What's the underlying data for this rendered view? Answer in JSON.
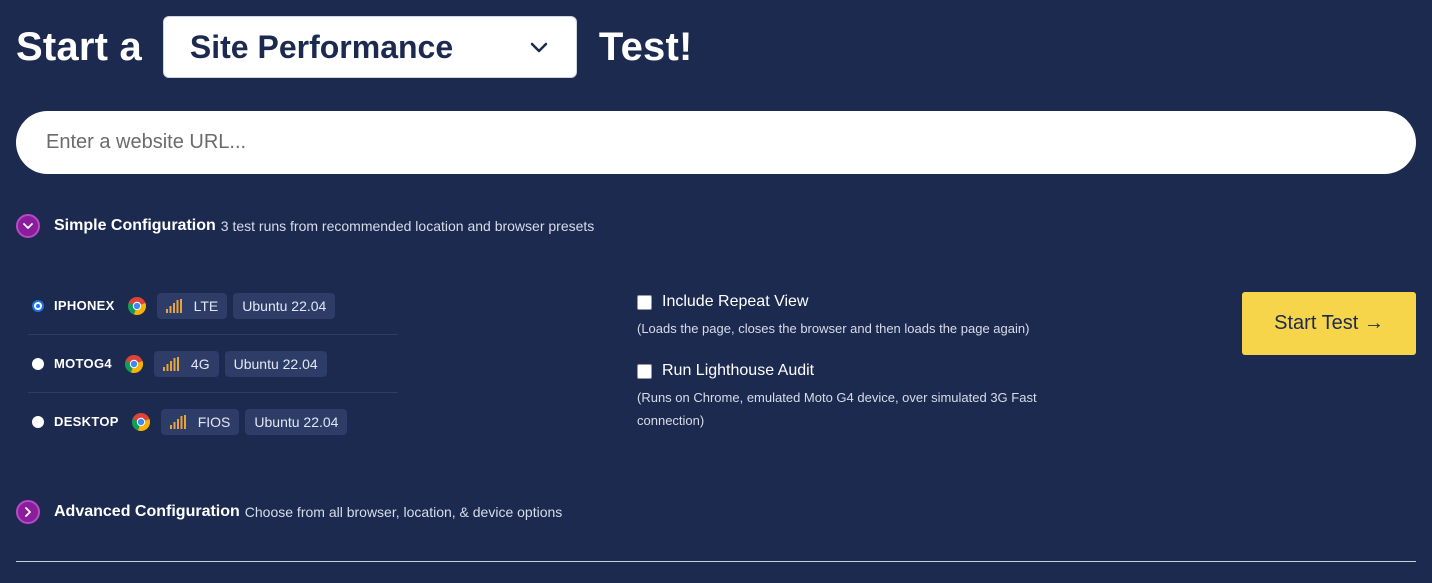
{
  "headline": {
    "prefix": "Start a",
    "selected_test": "Site Performance",
    "suffix": "Test!"
  },
  "url_input": {
    "placeholder": "Enter a website URL...",
    "value": ""
  },
  "simple_config": {
    "title": "Simple Configuration",
    "description": "3 test runs from recommended location and browser presets",
    "expanded": true
  },
  "presets": [
    {
      "device": "IPHONEX",
      "browser_icon": "chrome-icon",
      "connection": "LTE",
      "os": "Ubuntu 22.04",
      "selected": true
    },
    {
      "device": "MOTOG4",
      "browser_icon": "chrome-icon",
      "connection": "4G",
      "os": "Ubuntu 22.04",
      "selected": false
    },
    {
      "device": "DESKTOP",
      "browser_icon": "chrome-icon",
      "connection": "FIOS",
      "os": "Ubuntu 22.04",
      "selected": false
    }
  ],
  "options": {
    "repeat_view": {
      "label": "Include Repeat View",
      "help": "(Loads the page, closes the browser and then loads the page again)",
      "checked": false
    },
    "lighthouse": {
      "label": "Run Lighthouse Audit",
      "help": "(Runs on Chrome, emulated Moto G4 device, over simulated 3G Fast connection)",
      "checked": false
    }
  },
  "start_button": {
    "label": "Start Test →"
  },
  "advanced_config": {
    "title": "Advanced Configuration",
    "description": "Choose from all browser, location, & device options",
    "expanded": false
  },
  "colors": {
    "background": "#1c2a4f",
    "accent_purple": "#8a1d9a",
    "button_yellow": "#f7d54a",
    "chip_bg": "#2d3d68",
    "signal_orange": "#e8a33d"
  }
}
